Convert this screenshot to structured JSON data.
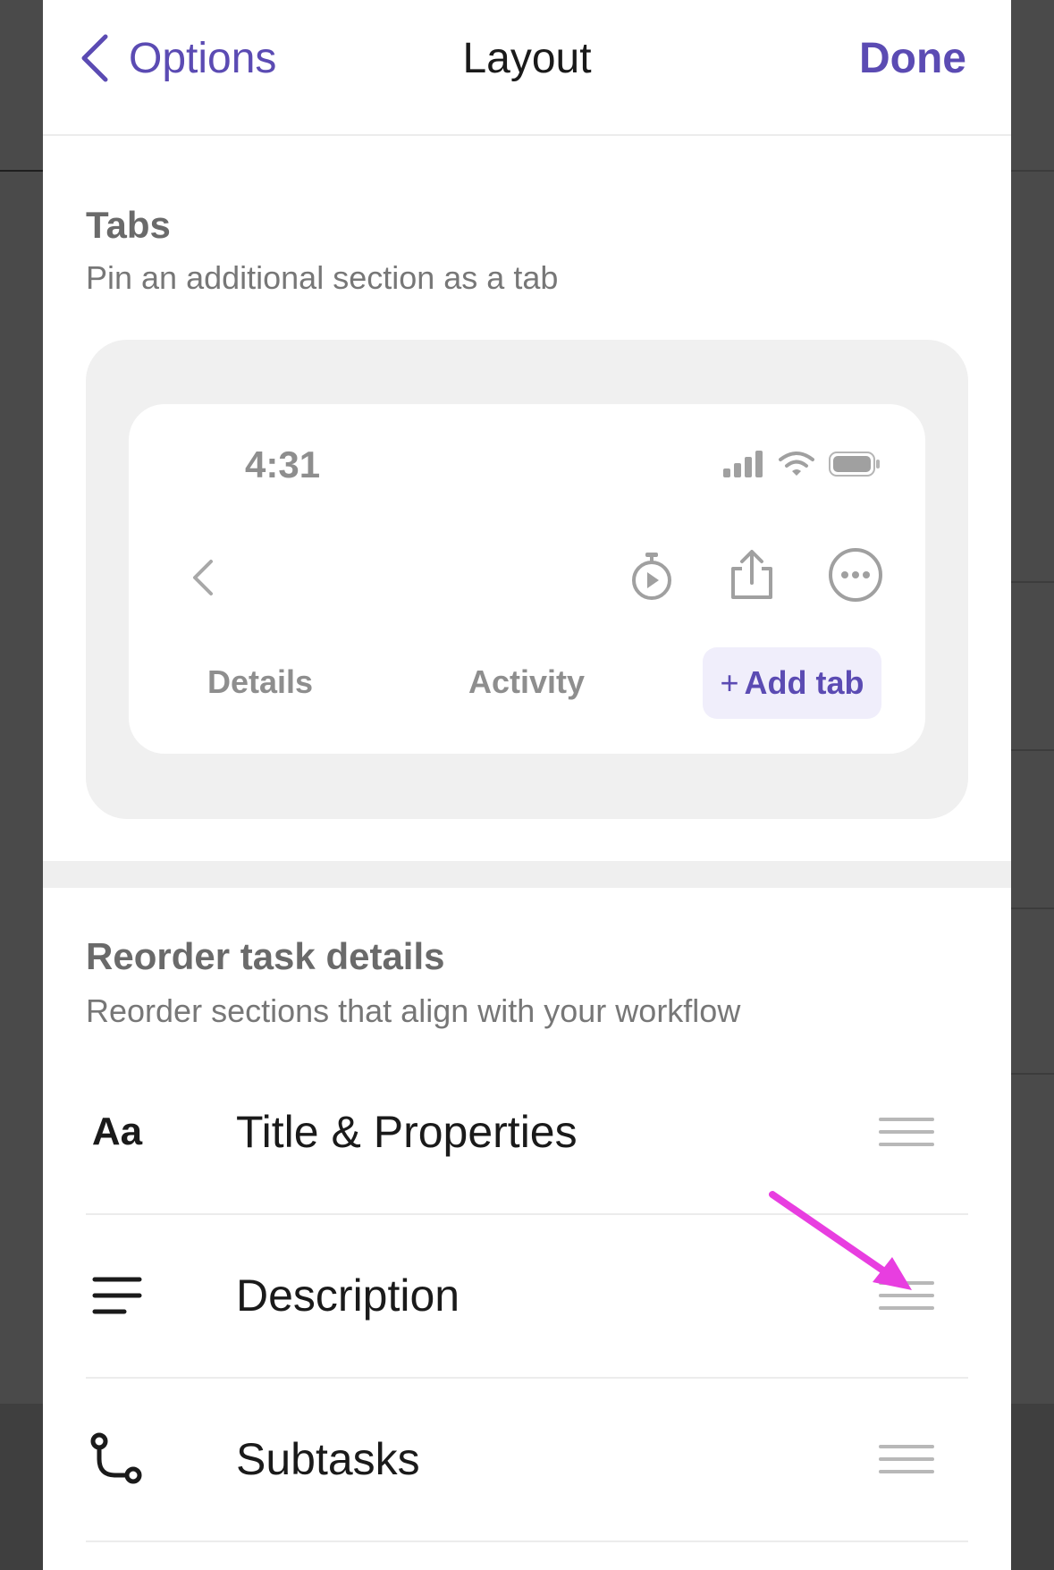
{
  "nav": {
    "back_label": "Options",
    "title": "Layout",
    "done_label": "Done"
  },
  "tabs_section": {
    "title": "Tabs",
    "subtitle": "Pin an additional section as a tab",
    "preview": {
      "time": "4:31",
      "tabs": [
        "Details",
        "Activity"
      ],
      "add_tab_icon": "+",
      "add_tab_label": "Add tab",
      "icons": [
        "chevron-left-icon",
        "timer-play-icon",
        "share-icon",
        "more-icon"
      ]
    }
  },
  "reorder_section": {
    "title": "Reorder task details",
    "subtitle": "Reorder sections that align with your workflow",
    "items": [
      {
        "icon": "Aa",
        "icon_name": "text-format-icon",
        "label": "Title & Properties"
      },
      {
        "icon_name": "description-lines-icon",
        "label": "Description"
      },
      {
        "icon_name": "subtasks-icon",
        "label": "Subtasks"
      }
    ]
  },
  "colors": {
    "accent": "#5b4bb3",
    "annotation_arrow": "#e83ee0",
    "tab_highlight": "#f0eefb"
  }
}
